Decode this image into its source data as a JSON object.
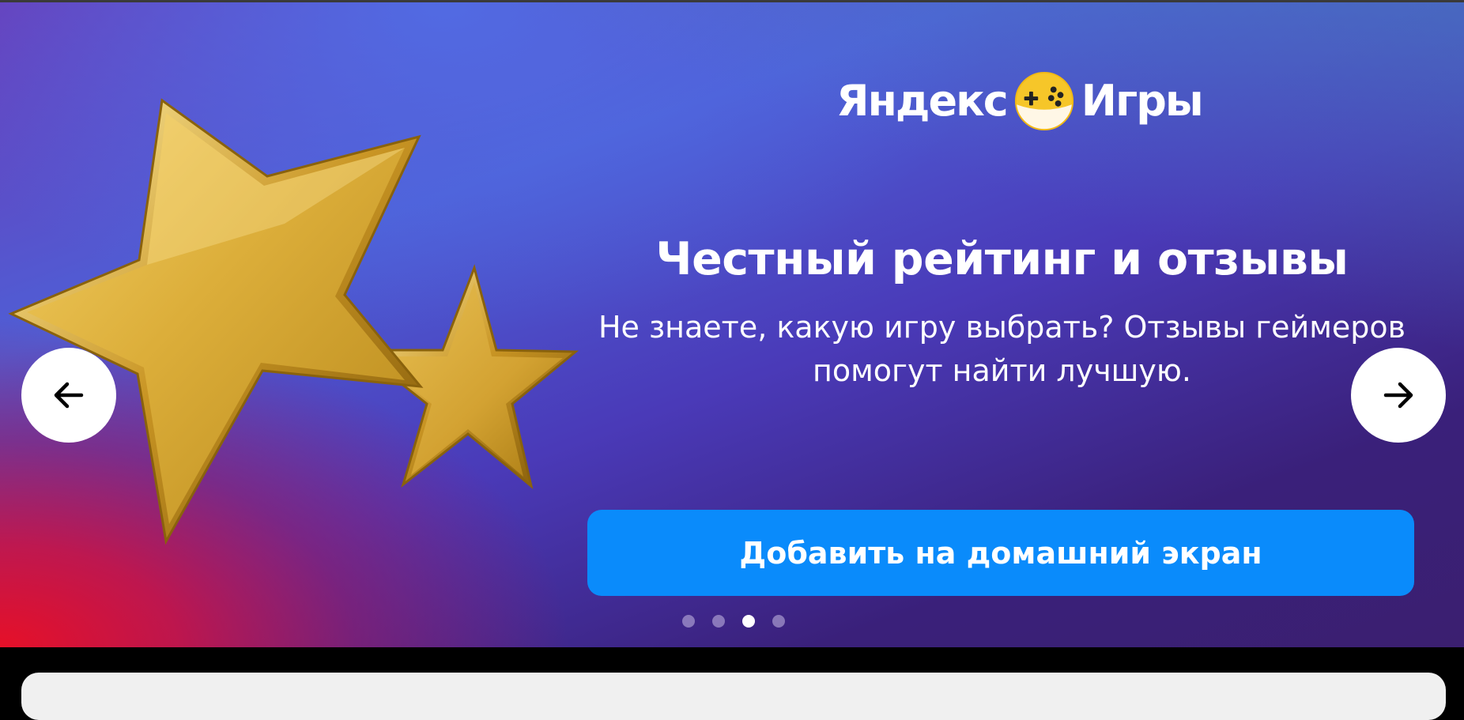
{
  "banner": {
    "logo": {
      "left_word": "Яндекс",
      "right_word": "Игры",
      "icon": "gamepad-ball-icon"
    },
    "title": "Честный рейтинг и отзывы",
    "subtitle": "Не знаете, какую игру выбрать? Отзывы геймеров помогут найти лучшую.",
    "cta_label": "Добавить на домашний экран",
    "pagination": {
      "total": 4,
      "active_index": 2
    },
    "prev_icon": "arrow-left-icon",
    "next_icon": "arrow-right-icon",
    "illustration": "gold-stars"
  },
  "colors": {
    "cta": "#0a8bfb",
    "gradient_red": "#e61028",
    "gradient_blue": "#4e5fd6",
    "gradient_purple": "#3b1f70",
    "star_gold": "#d4a62c"
  }
}
